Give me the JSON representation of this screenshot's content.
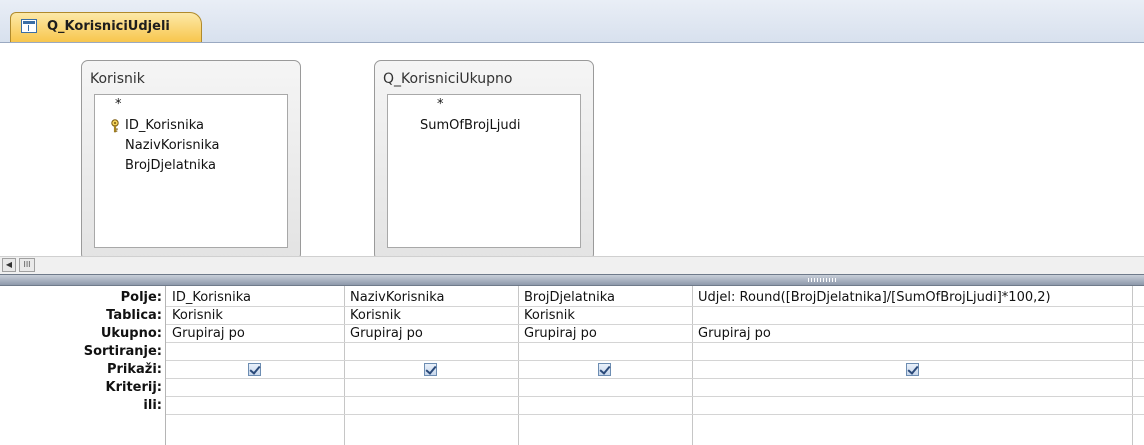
{
  "tab": {
    "title": "Q_KorisniciUdjeli",
    "icon": "query-icon"
  },
  "tables": [
    {
      "name": "Korisnik",
      "fields": [
        "*",
        "ID_Korisnika",
        "NazivKorisnika",
        "BrojDjelatnika"
      ],
      "primary_key": "ID_Korisnika"
    },
    {
      "name": "Q_KorisniciUkupno",
      "fields": [
        "*",
        "SumOfBrojLjudi"
      ]
    }
  ],
  "grid": {
    "row_labels": [
      "Polje:",
      "Tablica:",
      "Ukupno:",
      "Sortiranje:",
      "Prikaži:",
      "Kriterij:",
      "ili:"
    ],
    "columns": [
      {
        "polje": "ID_Korisnika",
        "tablica": "Korisnik",
        "ukupno": "Grupiraj po",
        "sortiranje": "",
        "prikazi": true
      },
      {
        "polje": "NazivKorisnika",
        "tablica": "Korisnik",
        "ukupno": "Grupiraj po",
        "sortiranje": "",
        "prikazi": true
      },
      {
        "polje": "BrojDjelatnika",
        "tablica": "Korisnik",
        "ukupno": "Grupiraj po",
        "sortiranje": "",
        "prikazi": true
      },
      {
        "polje": "Udjel: Round([BrojDjelatnika]/[SumOfBrojLjudi]*100,2)",
        "tablica": "",
        "ukupno": "Grupiraj po",
        "sortiranje": "",
        "prikazi": true
      }
    ]
  },
  "scrollbar": {
    "left_arrow": "◀",
    "thumb_glyph": "III"
  },
  "colors": {
    "tab_bg": "#f7c64d",
    "splitter": "#8e99ab",
    "checkbox_mark": "#2b4a7a"
  }
}
